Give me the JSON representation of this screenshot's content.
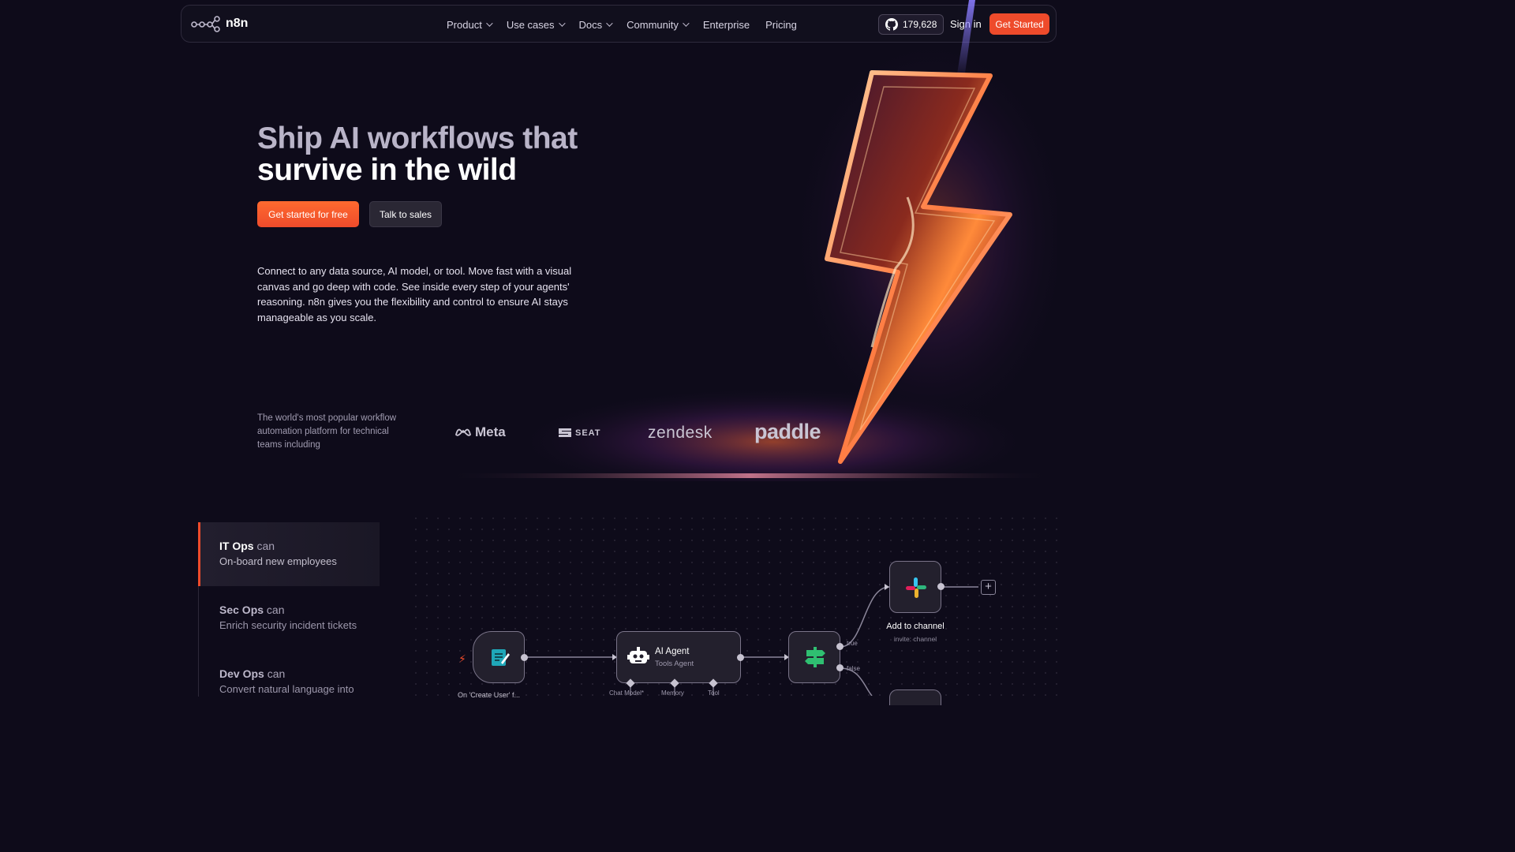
{
  "nav": {
    "brand": "n8n",
    "menu": [
      {
        "label": "Product",
        "has_dropdown": true
      },
      {
        "label": "Use cases",
        "has_dropdown": true
      },
      {
        "label": "Docs",
        "has_dropdown": true
      },
      {
        "label": "Community",
        "has_dropdown": true
      },
      {
        "label": "Enterprise",
        "has_dropdown": false
      },
      {
        "label": "Pricing",
        "has_dropdown": false
      }
    ],
    "github_stars": "179,628",
    "sign_in": "Sign in",
    "get_started": "Get Started"
  },
  "hero": {
    "title_line1": "Ship AI workflows that",
    "title_line2": "survive in the wild",
    "cta_primary": "Get started for free",
    "cta_secondary": "Talk to sales",
    "description": "Connect to any data source, AI model, or tool. Move fast with a visual canvas and go deep with code. See inside every step of your agents' reasoning. n8n gives you the flexibility and control to ensure AI stays manageable as you scale.",
    "trust_text": "The world's most popular workflow automation platform for technical teams including",
    "logos": [
      "Meta",
      "SEAT",
      "zendesk",
      "paddle"
    ]
  },
  "use_cases": [
    {
      "team": "IT Ops",
      "can": "can",
      "task": "On-board new employees",
      "active": true
    },
    {
      "team": "Sec Ops",
      "can": "can",
      "task": "Enrich security incident tickets",
      "active": false
    },
    {
      "team": "Dev Ops",
      "can": "can",
      "task": "Convert natural language into",
      "active": false
    }
  ],
  "workflow": {
    "trigger_label": "On 'Create User' f...",
    "agent_title": "AI Agent",
    "agent_sub": "Tools Agent",
    "agent_ports": [
      "Chat Model*",
      "Memory",
      "Tool"
    ],
    "branch_true": "true",
    "branch_false": "false",
    "slack_title": "Add to channel",
    "slack_sub": "invite: channel"
  },
  "colors": {
    "accent": "#ee4b2b",
    "background": "#0e0b1a"
  }
}
